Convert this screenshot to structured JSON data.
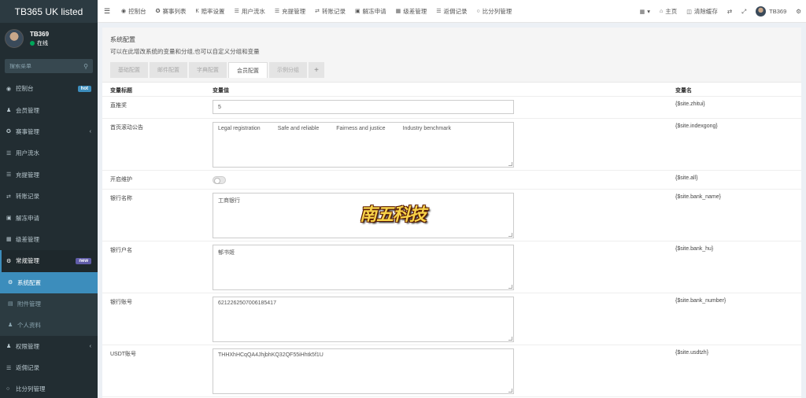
{
  "app": {
    "logo": "TB365 UK listed"
  },
  "user": {
    "name": "TB369",
    "status": "在线"
  },
  "sidebar": {
    "search_placeholder": "搜索菜单",
    "items": [
      {
        "label": "控制台",
        "icon": "dashboard-icon",
        "badge": "hot"
      },
      {
        "label": "会员管理",
        "icon": "users-icon"
      },
      {
        "label": "赛事管理",
        "icon": "gamepad-icon"
      },
      {
        "label": "用户流水",
        "icon": "list-icon"
      },
      {
        "label": "充提管理",
        "icon": "list-icon"
      },
      {
        "label": "转账记录",
        "icon": "transfer-icon"
      },
      {
        "label": "解冻申请",
        "icon": "image-icon"
      },
      {
        "label": "级差管理",
        "icon": "calendar-icon"
      },
      {
        "label": "常规管理",
        "icon": "cogs-icon",
        "badge": "new"
      },
      {
        "label": "系统配置",
        "icon": "gear-icon"
      },
      {
        "label": "附件管理",
        "icon": "file-icon"
      },
      {
        "label": "个人资料",
        "icon": "user-icon"
      },
      {
        "label": "权限管理",
        "icon": "group-icon"
      },
      {
        "label": "返佣记录",
        "icon": "list-icon"
      },
      {
        "label": "比分列管理",
        "icon": "circle-icon"
      }
    ]
  },
  "topnav": {
    "items": [
      {
        "label": "控制台",
        "icon": "dashboard-icon"
      },
      {
        "label": "赛事列表",
        "icon": "gamepad-icon"
      },
      {
        "label": "赔率设置",
        "icon": "vk-icon"
      },
      {
        "label": "用户流水",
        "icon": "list-icon"
      },
      {
        "label": "充提管理",
        "icon": "list-icon"
      },
      {
        "label": "转账记录",
        "icon": "transfer-icon"
      },
      {
        "label": "解冻申请",
        "icon": "image-icon"
      },
      {
        "label": "级差管理",
        "icon": "calendar-icon"
      },
      {
        "label": "返佣记录",
        "icon": "list-icon"
      },
      {
        "label": "比分列管理",
        "icon": "circle-icon"
      }
    ],
    "right": {
      "home": "主页",
      "clear_cache": "清除缓存",
      "username": "TB369"
    }
  },
  "panel": {
    "title": "系统配置",
    "description": "可以在此增改系统的变量和分组,也可以自定义分组和变量",
    "tabs": [
      "基础配置",
      "邮件配置",
      "字典配置",
      "会员配置",
      "示例分组"
    ],
    "active_tab": 3,
    "columns": [
      "变量标题",
      "变量值",
      "变量名"
    ],
    "rows": [
      {
        "title": "直推奖",
        "type": "input",
        "value": "5",
        "name": "{$site.zhitui}"
      },
      {
        "title": "首页滚动公告",
        "type": "ticker",
        "values": [
          "Legal registration",
          "Safe and reliable",
          "Fairness and justice",
          "Industry benchmark"
        ],
        "name": "{$site.indexgong}"
      },
      {
        "title": "开启维护",
        "type": "switch",
        "checked": false,
        "name": "{$site.all}"
      },
      {
        "title": "银行名称",
        "type": "textarea",
        "value": "工商银行",
        "name": "{$site.bank_name}"
      },
      {
        "title": "银行户名",
        "type": "textarea",
        "value": "郁书姬",
        "name": "{$site.bank_hu}"
      },
      {
        "title": "银行账号",
        "type": "textarea",
        "value": "6212262507006185417",
        "name": "{$site.bank_number}"
      },
      {
        "title": "USDT账号",
        "type": "textarea",
        "value": "THHXhHCqQA4JhjbhKQ32QF55iHhtk5f1U",
        "name": "{$site.usdtzh}"
      }
    ]
  },
  "watermark": "南五科技",
  "colors": {
    "sidebar_bg": "#222d32",
    "active": "#3c8dbc",
    "hot_badge": "#3c8dbc",
    "new_badge": "#605ca8",
    "online": "#00a65a"
  }
}
